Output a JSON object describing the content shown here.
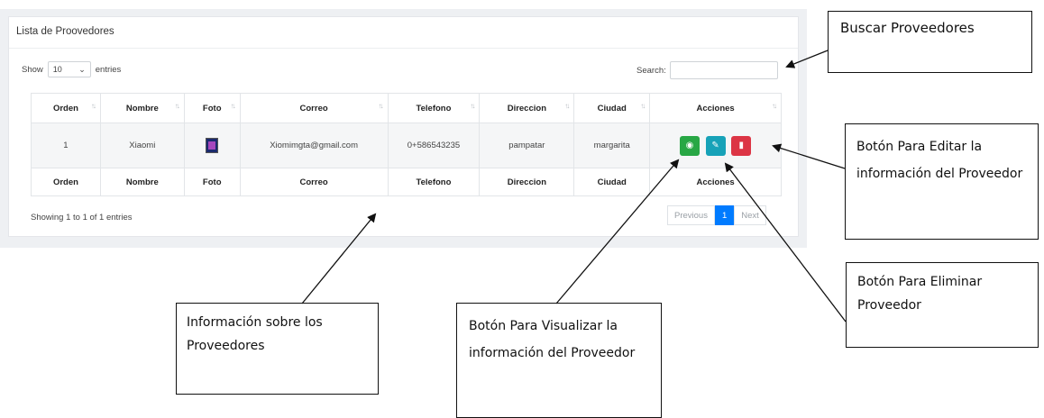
{
  "panel": {
    "title": "Lista de Proovedores"
  },
  "length": {
    "prefix": "Show",
    "value": "10",
    "suffix": "entries"
  },
  "search": {
    "label": "Search:"
  },
  "table": {
    "columns": [
      "Orden",
      "Nombre",
      "Foto",
      "Correo",
      "Telefono",
      "Direccion",
      "Ciudad",
      "Acciones"
    ],
    "rows": [
      {
        "orden": "1",
        "nombre": "Xiaomi",
        "correo": "Xiomimgta@gmail.com",
        "telefono": "0+586543235",
        "direccion": "pampatar",
        "ciudad": "margarita"
      }
    ],
    "footer": [
      "Orden",
      "Nombre",
      "Foto",
      "Correo",
      "Telefono",
      "Direccion",
      "Ciudad",
      "Acciones"
    ]
  },
  "info": "Showing 1 to 1 of 1 entries",
  "pagination": {
    "previous": "Previous",
    "current": "1",
    "next": "Next"
  },
  "callouts": {
    "buscar": "Buscar Proveedores",
    "editar": "Botón Para Editar  la información del Proveedor",
    "eliminar": "Botón Para Eliminar Proveedor",
    "informacion": "Información sobre los Proveedores",
    "visualizar": "Botón Para Visualizar la información del Proveedor"
  },
  "colors": {
    "view": "#28a745",
    "edit": "#17a2b8",
    "delete": "#dc3545",
    "page_active": "#007bff"
  }
}
